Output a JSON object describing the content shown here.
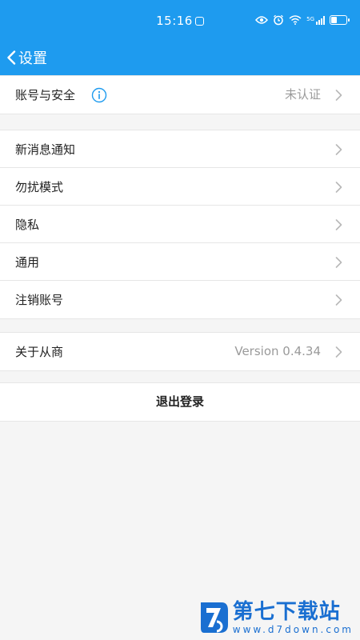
{
  "status_bar": {
    "time": "15:16",
    "network": "5G"
  },
  "header": {
    "title": "设置"
  },
  "account": {
    "label": "账号与安全",
    "value": "未认证"
  },
  "menu": {
    "items": [
      {
        "label": "新消息通知"
      },
      {
        "label": "勿扰模式"
      },
      {
        "label": "隐私"
      },
      {
        "label": "通用"
      },
      {
        "label": "注销账号"
      }
    ]
  },
  "about": {
    "label": "关于从商",
    "value": "Version 0.4.34"
  },
  "logout": {
    "label": "退出登录"
  },
  "watermark": {
    "name": "第七下载站",
    "url": "www.d7down.com"
  },
  "colors": {
    "brand": "#1e9bef",
    "background": "#f5f5f5",
    "chevron": "#b8b8b8",
    "watermark": "#1a6fd1"
  }
}
